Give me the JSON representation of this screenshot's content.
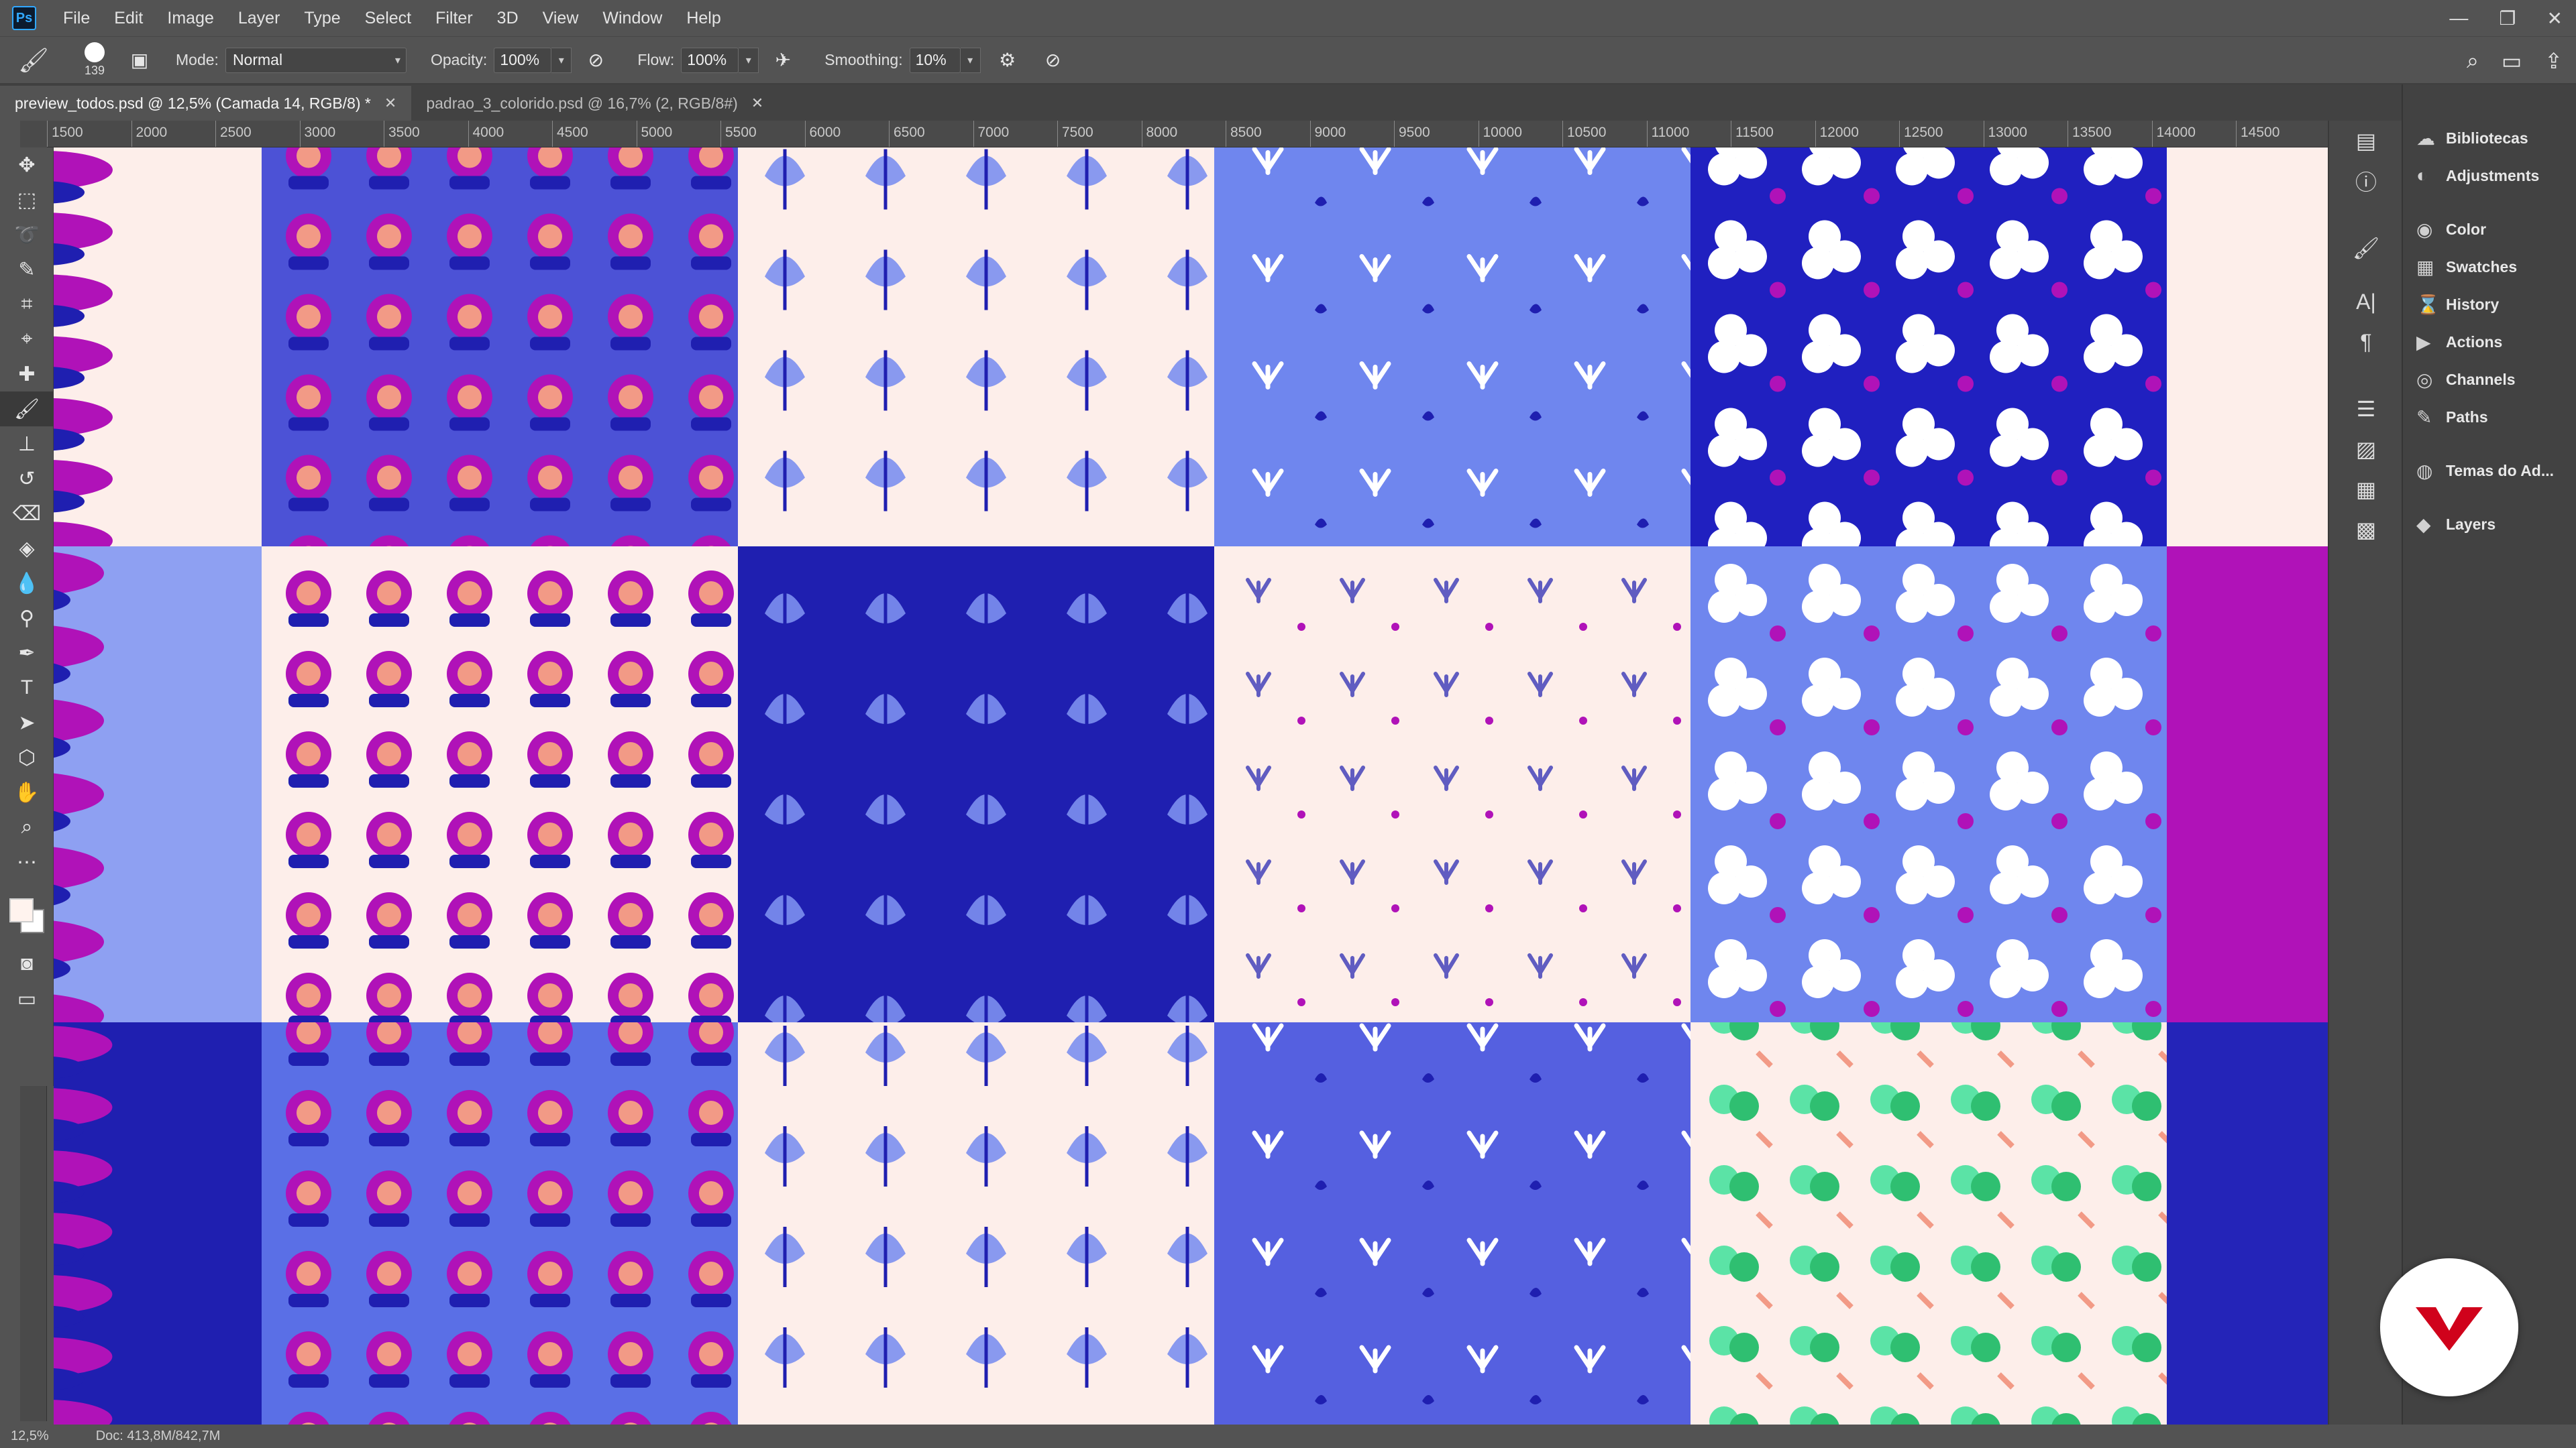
{
  "app": {
    "logo_text": "Ps"
  },
  "menu": [
    "File",
    "Edit",
    "Image",
    "Layer",
    "Type",
    "Select",
    "Filter",
    "3D",
    "View",
    "Window",
    "Help"
  ],
  "window_controls": [
    "—",
    "❐",
    "✕"
  ],
  "options": {
    "brush_size": "139",
    "mode_label": "Mode:",
    "mode_value": "Normal",
    "opacity_label": "Opacity:",
    "opacity_value": "100%",
    "flow_label": "Flow:",
    "flow_value": "100%",
    "smoothing_label": "Smoothing:",
    "smoothing_value": "10%"
  },
  "tabs": [
    {
      "label": "preview_todos.psd @ 12,5% (Camada 14, RGB/8) *",
      "active": true
    },
    {
      "label": "padrao_3_colorido.psd @ 16,7% (2, RGB/8#)",
      "active": false
    }
  ],
  "ruler_labels": [
    "1500",
    "2000",
    "2500",
    "3000",
    "3500",
    "4000",
    "4500",
    "5000",
    "5500",
    "6000",
    "6500",
    "7000",
    "7500",
    "8000",
    "8500",
    "9000",
    "9500",
    "10000",
    "10500",
    "11000",
    "11500",
    "12000",
    "12500",
    "13000",
    "13500",
    "14000",
    "14500"
  ],
  "panels": [
    {
      "label": "Bibliotecas",
      "icon": "libraries-icon",
      "glyph": "☁"
    },
    {
      "label": "Adjustments",
      "icon": "adjustments-icon",
      "glyph": "◐"
    },
    {
      "label": "Color",
      "icon": "color-icon",
      "glyph": "◉"
    },
    {
      "label": "Swatches",
      "icon": "swatches-icon",
      "glyph": "▦"
    },
    {
      "label": "History",
      "icon": "history-icon",
      "glyph": "⌛"
    },
    {
      "label": "Actions",
      "icon": "actions-icon",
      "glyph": "▶"
    },
    {
      "label": "Channels",
      "icon": "channels-icon",
      "glyph": "◎"
    },
    {
      "label": "Paths",
      "icon": "paths-icon",
      "glyph": "✎"
    },
    {
      "label": "Temas do Ad...",
      "icon": "themes-icon",
      "glyph": "◍"
    },
    {
      "label": "Layers",
      "icon": "layers-icon",
      "glyph": "◆"
    }
  ],
  "status": {
    "zoom": "12,5%",
    "doc": "Doc: 413,8M/842,7M"
  },
  "colors": {
    "bg_dark": "#535353",
    "pattern_blue": "#1f1fb0",
    "pattern_periwinkle": "#7c8ff0",
    "pattern_magenta": "#b012b8",
    "pattern_cream": "#fdeeea",
    "pattern_mint": "#5be3a6",
    "pattern_salmon": "#f29a86",
    "badge_red": "#d0021b"
  }
}
